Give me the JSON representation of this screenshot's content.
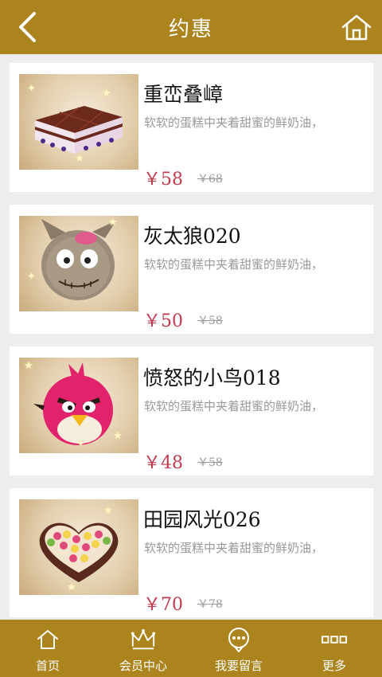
{
  "header": {
    "title": "约惠",
    "back_icon": "chevron-left-icon",
    "home_icon": "home-icon"
  },
  "products": [
    {
      "name": "重峦叠嶂",
      "desc": "软软的蛋糕中夹着甜蜜的鲜奶油，",
      "price": "￥58",
      "old_price": "￥68",
      "image": "layered-square-cake"
    },
    {
      "name": "灰太狼020",
      "desc": "软软的蛋糕中夹着甜蜜的鲜奶油，",
      "price": "￥50",
      "old_price": "￥58",
      "image": "grey-wolf-cake"
    },
    {
      "name": "愤怒的小鸟018",
      "desc": "软软的蛋糕中夹着甜蜜的鲜奶油，",
      "price": "￥48",
      "old_price": "￥58",
      "image": "angry-bird-cake"
    },
    {
      "name": "田园风光026",
      "desc": "软软的蛋糕中夹着甜蜜的鲜奶油，",
      "price": "￥70",
      "old_price": "￥78",
      "image": "heart-fruit-cake"
    }
  ],
  "tabbar": [
    {
      "label": "首页",
      "icon": "home-icon"
    },
    {
      "label": "会员中心",
      "icon": "crown-icon"
    },
    {
      "label": "我要留言",
      "icon": "message-icon"
    },
    {
      "label": "更多",
      "icon": "more-icon"
    }
  ],
  "colors": {
    "brand": "#ac841d",
    "price": "#c23a4e",
    "background": "#ededed"
  }
}
